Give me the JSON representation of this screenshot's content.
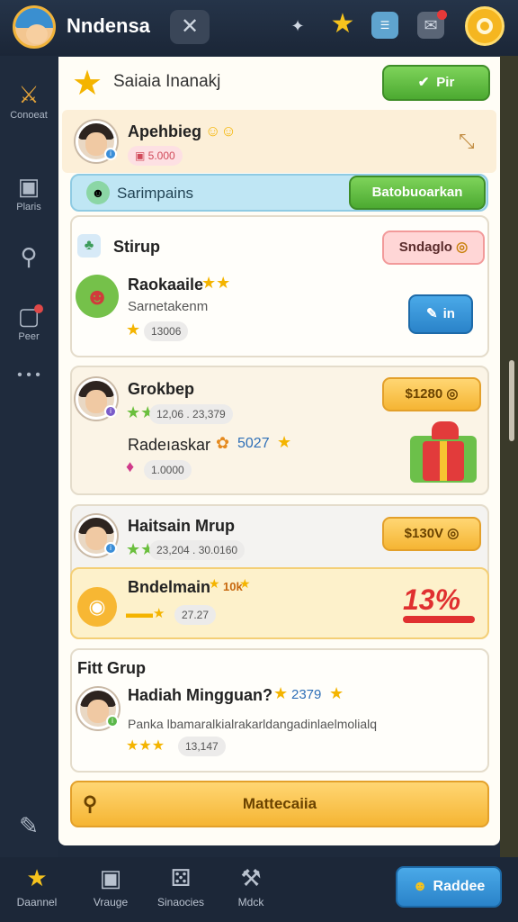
{
  "header": {
    "title": "Nndensa",
    "close": "✕"
  },
  "sidebar": [
    {
      "label": "Conoeat",
      "icon": "sword-icon",
      "glyph": "⚔"
    },
    {
      "label": "Plaris",
      "icon": "clipboard-icon",
      "glyph": "▣"
    },
    {
      "label": "",
      "icon": "search-icon",
      "glyph": "⚲"
    },
    {
      "label": "Peer",
      "icon": "chat-icon",
      "glyph": "▢"
    },
    {
      "label": "",
      "icon": "more-icon",
      "glyph": "• • •"
    },
    {
      "label": "",
      "icon": "edit-icon",
      "glyph": "✎"
    }
  ],
  "panel": {
    "title": "Saiaia Inanakj",
    "title_button": "Pir",
    "highlight": {
      "name": "Apehbieg",
      "amount": "5.000"
    },
    "search": {
      "placeholder": "Sarimpains",
      "button": "Batobuoarkan"
    },
    "group1": {
      "title": "Stirup",
      "button": "Sndaglo",
      "member": "Raokaaile",
      "subtitle": "Sarnetakenm",
      "chip": "13006",
      "action": "in"
    },
    "group2": {
      "name": "Grokbep",
      "stats": "12,06 . 23,379",
      "reward_label": "Radeıaskar",
      "reward_value": "5027",
      "chip": "1.0000",
      "button": "$1280"
    },
    "group3": {
      "name": "Haitsain Mrup",
      "stats": "23,204 . 30.0160",
      "button": "$130V",
      "event_name": "Bndelmain",
      "event_badge": "10k",
      "chip": "27.27",
      "discount": "13%"
    },
    "fitgrup": {
      "title": "Fitt Grup",
      "heading": "Hadiah Mingguan?",
      "heading_value": "2379",
      "description": "Panka lbamaralkialrakarldangadinlaelmolialq",
      "chip": "13,147"
    },
    "main_button": "Mattecaiia"
  },
  "bottom": [
    {
      "label": "Daannel",
      "icon": "star-icon"
    },
    {
      "label": "Vrauge",
      "icon": "image-icon"
    },
    {
      "label": "Sinaocies",
      "icon": "dice-icon"
    },
    {
      "label": "Mdck",
      "icon": "hammer-icon"
    }
  ],
  "bottom_button": "Raddee"
}
